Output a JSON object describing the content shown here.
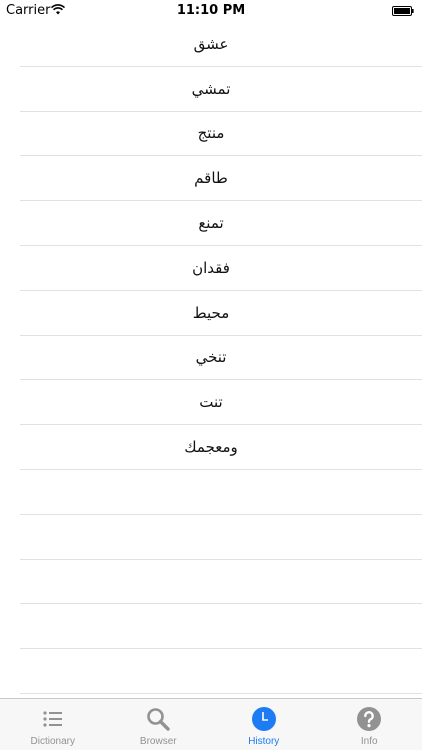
{
  "status_bar": {
    "carrier": "Carrier",
    "time": "11:10 PM"
  },
  "history": {
    "items": [
      "عشق",
      "تمشي",
      "منتج",
      "طاقم",
      "تمنع",
      "فقدان",
      "محيط",
      "تنخي",
      "تنت",
      "ومعجمك",
      "",
      "",
      "",
      "",
      ""
    ]
  },
  "tab_bar": {
    "tabs": [
      {
        "label": "Dictionary",
        "icon": "list-icon",
        "active": false
      },
      {
        "label": "Browser",
        "icon": "magnifier-icon",
        "active": false
      },
      {
        "label": "History",
        "icon": "clock-icon",
        "active": true
      },
      {
        "label": "Info",
        "icon": "question-icon",
        "active": false
      }
    ]
  },
  "colors": {
    "active_tab": "#1d7cf4",
    "inactive_tab": "#929292",
    "separator": "#e1e1e1"
  }
}
